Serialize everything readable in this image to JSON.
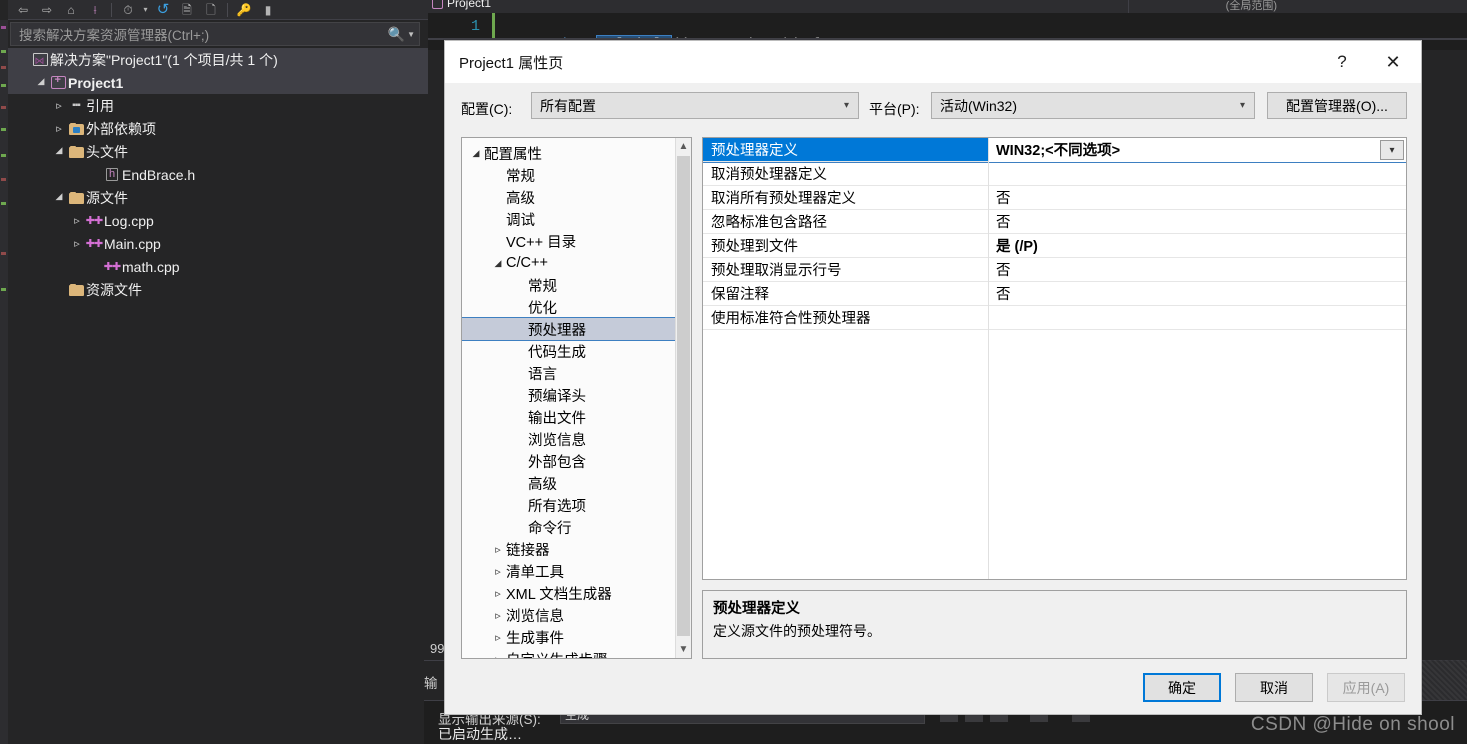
{
  "shell": {
    "toolbar_icons": [
      "back-icon",
      "forward-icon",
      "home-icon",
      "sync-with-editor-icon",
      "pending-changes-icon",
      "refresh-icon",
      "show-all-files-icon",
      "collapse-all-icon",
      "properties-icon",
      "preview-selected-items-icon"
    ],
    "search": {
      "placeholder": "搜索解决方案资源管理器(Ctrl+;)",
      "magnifier": "search-icon",
      "dropdown": "chevron-down-icon"
    },
    "tree": [
      {
        "label": "解决方案\"Project1\"(1 个项目/共 1 个)",
        "icon": "solution-icon",
        "indent": 0,
        "twisty": "none",
        "selected": true,
        "bold": false
      },
      {
        "label": "Project1",
        "icon": "project-icon",
        "indent": 1,
        "twisty": "open",
        "selected": true,
        "bold": true
      },
      {
        "label": "引用",
        "icon": "references-icon",
        "indent": 2,
        "twisty": "closed",
        "selected": false,
        "bold": false
      },
      {
        "label": "外部依赖项",
        "icon": "external-dependencies-icon",
        "indent": 2,
        "twisty": "closed",
        "selected": false,
        "bold": false
      },
      {
        "label": "头文件",
        "icon": "folder-filter-icon",
        "indent": 2,
        "twisty": "open",
        "selected": false,
        "bold": false
      },
      {
        "label": "EndBrace.h",
        "icon": "header-file-icon",
        "indent": 4,
        "twisty": "none",
        "selected": false,
        "bold": false
      },
      {
        "label": "源文件",
        "icon": "folder-filter-icon",
        "indent": 2,
        "twisty": "open",
        "selected": false,
        "bold": false
      },
      {
        "label": "Log.cpp",
        "icon": "cpp-file-icon",
        "indent": 3,
        "twisty": "closed",
        "selected": false,
        "bold": false
      },
      {
        "label": "Main.cpp",
        "icon": "cpp-file-icon",
        "indent": 3,
        "twisty": "closed",
        "selected": false,
        "bold": false
      },
      {
        "label": "math.cpp",
        "icon": "cpp-file-icon",
        "indent": 4,
        "twisty": "none",
        "selected": false,
        "bold": false
      },
      {
        "label": "资源文件",
        "icon": "folder-filter-icon",
        "indent": 2,
        "twisty": "none",
        "selected": false,
        "bold": false
      }
    ],
    "editor": {
      "tab_label": "Project1",
      "scope_hint": "(全局范围)",
      "line_number": "1",
      "code_pre": "int ",
      "code_selected": "Multiply",
      "code_post": "(int a, int b) {"
    },
    "panes": {
      "error_count": "99",
      "output_label": "输",
      "output_filter_label": "显示输出来源(S):",
      "output_filter_value": "生成",
      "output_text": "已启动生成…"
    },
    "watermark": "CSDN @Hide on shool"
  },
  "dialog": {
    "title": "Project1 属性页",
    "help_glyph": "?",
    "close_glyph": "✕",
    "config_label": "配置(C):",
    "config_value": "所有配置",
    "platform_label": "平台(P):",
    "platform_value": "活动(Win32)",
    "config_manager_button": "配置管理器(O)...",
    "tree": [
      {
        "label": "配置属性",
        "indent": 0,
        "twisty": "open",
        "selected": false
      },
      {
        "label": "常规",
        "indent": 1,
        "twisty": "none",
        "selected": false
      },
      {
        "label": "高级",
        "indent": 1,
        "twisty": "none",
        "selected": false
      },
      {
        "label": "调试",
        "indent": 1,
        "twisty": "none",
        "selected": false
      },
      {
        "label": "VC++ 目录",
        "indent": 1,
        "twisty": "none",
        "selected": false
      },
      {
        "label": "C/C++",
        "indent": 1,
        "twisty": "open",
        "selected": false
      },
      {
        "label": "常规",
        "indent": 2,
        "twisty": "none",
        "selected": false
      },
      {
        "label": "优化",
        "indent": 2,
        "twisty": "none",
        "selected": false
      },
      {
        "label": "预处理器",
        "indent": 2,
        "twisty": "none",
        "selected": true
      },
      {
        "label": "代码生成",
        "indent": 2,
        "twisty": "none",
        "selected": false
      },
      {
        "label": "语言",
        "indent": 2,
        "twisty": "none",
        "selected": false
      },
      {
        "label": "预编译头",
        "indent": 2,
        "twisty": "none",
        "selected": false
      },
      {
        "label": "输出文件",
        "indent": 2,
        "twisty": "none",
        "selected": false
      },
      {
        "label": "浏览信息",
        "indent": 2,
        "twisty": "none",
        "selected": false
      },
      {
        "label": "外部包含",
        "indent": 2,
        "twisty": "none",
        "selected": false
      },
      {
        "label": "高级",
        "indent": 2,
        "twisty": "none",
        "selected": false
      },
      {
        "label": "所有选项",
        "indent": 2,
        "twisty": "none",
        "selected": false
      },
      {
        "label": "命令行",
        "indent": 2,
        "twisty": "none",
        "selected": false
      },
      {
        "label": "链接器",
        "indent": 1,
        "twisty": "closed",
        "selected": false
      },
      {
        "label": "清单工具",
        "indent": 1,
        "twisty": "closed",
        "selected": false
      },
      {
        "label": "XML 文档生成器",
        "indent": 1,
        "twisty": "closed",
        "selected": false
      },
      {
        "label": "浏览信息",
        "indent": 1,
        "twisty": "closed",
        "selected": false
      },
      {
        "label": "生成事件",
        "indent": 1,
        "twisty": "closed",
        "selected": false
      },
      {
        "label": "自定义生成步骤",
        "indent": 1,
        "twisty": "closed",
        "selected": false
      }
    ],
    "grid": [
      {
        "name": "预处理器定义",
        "value": "WIN32;<不同选项>",
        "selected": true,
        "bold": true,
        "dropdown": true
      },
      {
        "name": "取消预处理器定义",
        "value": "",
        "selected": false,
        "bold": false,
        "dropdown": false
      },
      {
        "name": "取消所有预处理器定义",
        "value": "否",
        "selected": false,
        "bold": false,
        "dropdown": false
      },
      {
        "name": "忽略标准包含路径",
        "value": "否",
        "selected": false,
        "bold": false,
        "dropdown": false
      },
      {
        "name": "预处理到文件",
        "value": "是 (/P)",
        "selected": false,
        "bold": true,
        "dropdown": false
      },
      {
        "name": "预处理取消显示行号",
        "value": "否",
        "selected": false,
        "bold": false,
        "dropdown": false
      },
      {
        "name": "保留注释",
        "value": "否",
        "selected": false,
        "bold": false,
        "dropdown": false
      },
      {
        "name": "使用标准符合性预处理器",
        "value": "",
        "selected": false,
        "bold": false,
        "dropdown": false
      }
    ],
    "description": {
      "title": "预处理器定义",
      "body": "定义源文件的预处理符号。"
    },
    "buttons": {
      "ok": "确定",
      "cancel": "取消",
      "apply": "应用(A)"
    }
  },
  "colors": {
    "accent_blue": "#0078d7",
    "dialog_bg": "#f0f0f0",
    "shell_bg": "#252526",
    "tree_selected": "#c5cbd9",
    "editor_bg": "#1e1e1e"
  }
}
